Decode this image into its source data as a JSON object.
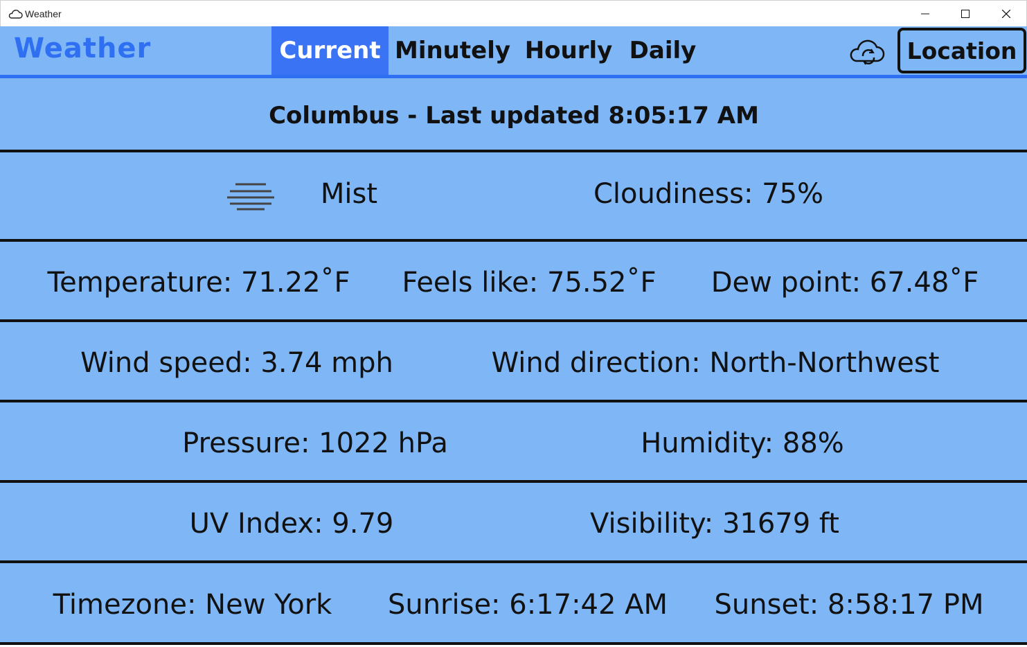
{
  "window": {
    "title": "Weather",
    "minimize_icon": "minimize-icon",
    "maximize_icon": "maximize-icon",
    "close_icon": "close-icon"
  },
  "appbar": {
    "brand": "Weather",
    "tabs": [
      "Current",
      "Minutely",
      "Hourly",
      "Daily"
    ],
    "active_tab": "Current",
    "refresh_icon": "cloud-refresh-icon",
    "location_label": "Location"
  },
  "colors": {
    "background": "#7fb6f6",
    "accent": "#2f6ff2",
    "active_tab": "#3b73f5",
    "divider": "#111111"
  },
  "current": {
    "headline": "Columbus - Last updated 8:05:17 AM",
    "condition_icon": "mist-icon",
    "condition": "Mist",
    "cloudiness": "Cloudiness: 75%",
    "temperature": "Temperature: 71.22˚F",
    "feels_like": "Feels like: 75.52˚F",
    "dew_point": "Dew point: 67.48˚F",
    "wind_speed": "Wind speed: 3.74 mph",
    "wind_direction": "Wind direction: North-Northwest",
    "pressure": "Pressure: 1022 hPa",
    "humidity": "Humidity: 88%",
    "uv_index": "UV Index: 9.79",
    "visibility": "Visibility: 31679 ft",
    "timezone": "Timezone: New York",
    "sunrise": "Sunrise: 6:17:42 AM",
    "sunset": "Sunset: 8:58:17 PM"
  }
}
